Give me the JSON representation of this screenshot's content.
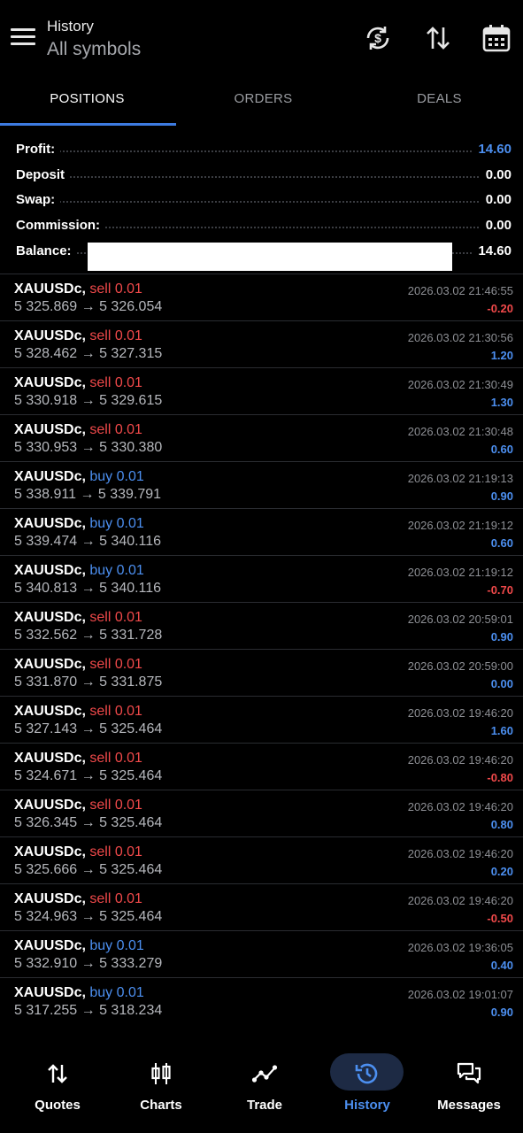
{
  "header": {
    "title": "History",
    "subtitle": "All symbols"
  },
  "tabs": [
    {
      "label": "POSITIONS",
      "active": true
    },
    {
      "label": "ORDERS",
      "active": false
    },
    {
      "label": "DEALS",
      "active": false
    }
  ],
  "summary": {
    "profit_label": "Profit:",
    "profit_value": "14.60",
    "deposit_label": "Deposit",
    "deposit_value": "0.00",
    "swap_label": "Swap:",
    "swap_value": "0.00",
    "commission_label": "Commission:",
    "commission_value": "0.00",
    "balance_label": "Balance:",
    "balance_value": "14.60"
  },
  "positions": [
    {
      "symbol": "XAUUSDc,",
      "side": "sell 0.01",
      "type": "sell",
      "prices": "5 325.869 → 5 326.054",
      "time": "2026.03.02 21:46:55",
      "profit": "-0.20"
    },
    {
      "symbol": "XAUUSDc,",
      "side": "sell 0.01",
      "type": "sell",
      "prices": "5 328.462 → 5 327.315",
      "time": "2026.03.02 21:30:56",
      "profit": "1.20"
    },
    {
      "symbol": "XAUUSDc,",
      "side": "sell 0.01",
      "type": "sell",
      "prices": "5 330.918 → 5 329.615",
      "time": "2026.03.02 21:30:49",
      "profit": "1.30"
    },
    {
      "symbol": "XAUUSDc,",
      "side": "sell 0.01",
      "type": "sell",
      "prices": "5 330.953 → 5 330.380",
      "time": "2026.03.02 21:30:48",
      "profit": "0.60"
    },
    {
      "symbol": "XAUUSDc,",
      "side": "buy 0.01",
      "type": "buy",
      "prices": "5 338.911 → 5 339.791",
      "time": "2026.03.02 21:19:13",
      "profit": "0.90"
    },
    {
      "symbol": "XAUUSDc,",
      "side": "buy 0.01",
      "type": "buy",
      "prices": "5 339.474 → 5 340.116",
      "time": "2026.03.02 21:19:12",
      "profit": "0.60"
    },
    {
      "symbol": "XAUUSDc,",
      "side": "buy 0.01",
      "type": "buy",
      "prices": "5 340.813 → 5 340.116",
      "time": "2026.03.02 21:19:12",
      "profit": "-0.70"
    },
    {
      "symbol": "XAUUSDc,",
      "side": "sell 0.01",
      "type": "sell",
      "prices": "5 332.562 → 5 331.728",
      "time": "2026.03.02 20:59:01",
      "profit": "0.90"
    },
    {
      "symbol": "XAUUSDc,",
      "side": "sell 0.01",
      "type": "sell",
      "prices": "5 331.870 → 5 331.875",
      "time": "2026.03.02 20:59:00",
      "profit": "0.00"
    },
    {
      "symbol": "XAUUSDc,",
      "side": "sell 0.01",
      "type": "sell",
      "prices": "5 327.143 → 5 325.464",
      "time": "2026.03.02 19:46:20",
      "profit": "1.60"
    },
    {
      "symbol": "XAUUSDc,",
      "side": "sell 0.01",
      "type": "sell",
      "prices": "5 324.671 → 5 325.464",
      "time": "2026.03.02 19:46:20",
      "profit": "-0.80"
    },
    {
      "symbol": "XAUUSDc,",
      "side": "sell 0.01",
      "type": "sell",
      "prices": "5 326.345 → 5 325.464",
      "time": "2026.03.02 19:46:20",
      "profit": "0.80"
    },
    {
      "symbol": "XAUUSDc,",
      "side": "sell 0.01",
      "type": "sell",
      "prices": "5 325.666 → 5 325.464",
      "time": "2026.03.02 19:46:20",
      "profit": "0.20"
    },
    {
      "symbol": "XAUUSDc,",
      "side": "sell 0.01",
      "type": "sell",
      "prices": "5 324.963 → 5 325.464",
      "time": "2026.03.02 19:46:20",
      "profit": "-0.50"
    },
    {
      "symbol": "XAUUSDc,",
      "side": "buy 0.01",
      "type": "buy",
      "prices": "5 332.910 → 5 333.279",
      "time": "2026.03.02 19:36:05",
      "profit": "0.40"
    },
    {
      "symbol": "XAUUSDc,",
      "side": "buy 0.01",
      "type": "buy",
      "prices": "5 317.255 → 5 318.234",
      "time": "2026.03.02 19:01:07",
      "profit": "0.90"
    }
  ],
  "bottom_nav": [
    {
      "label": "Quotes",
      "icon": "quotes-arrows-icon",
      "active": false
    },
    {
      "label": "Charts",
      "icon": "candlestick-icon",
      "active": false
    },
    {
      "label": "Trade",
      "icon": "trend-line-icon",
      "active": false
    },
    {
      "label": "History",
      "icon": "history-clock-icon",
      "active": true
    },
    {
      "label": "Messages",
      "icon": "chat-bubbles-icon",
      "active": false
    }
  ],
  "colors": {
    "accent_blue": "#4c8ff0",
    "sell_red": "#f0494a",
    "background": "#000000"
  }
}
